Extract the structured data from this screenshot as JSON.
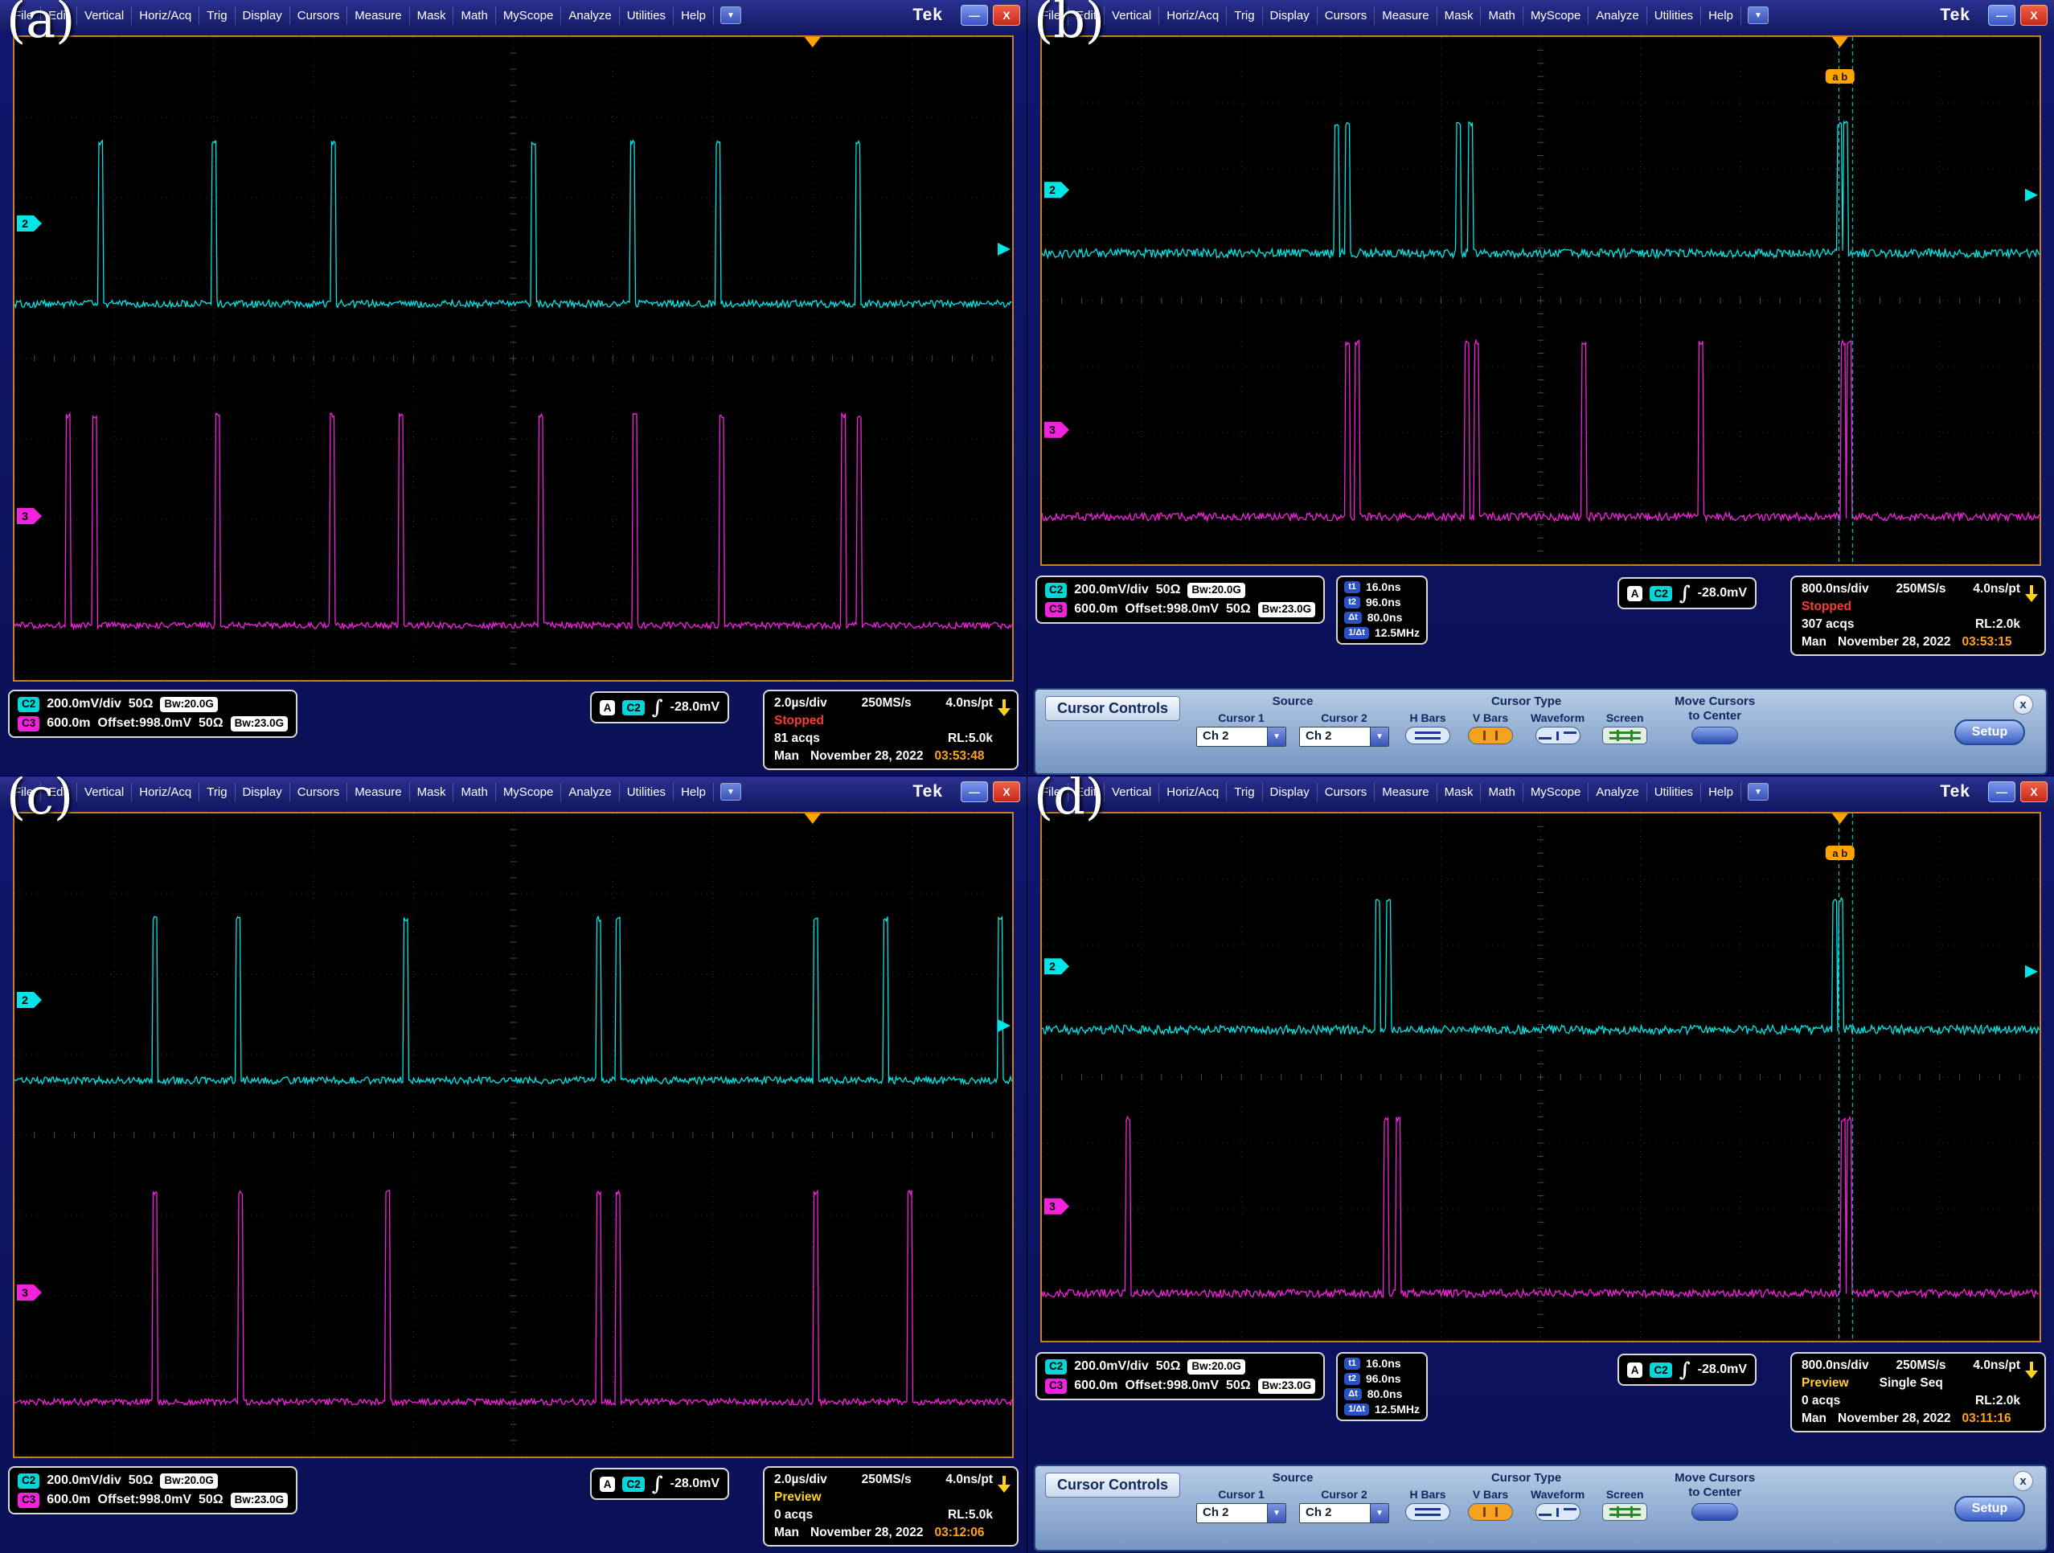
{
  "logo": "Tek",
  "icons": {
    "dropdown": "▼",
    "minimize": "—",
    "close": "X"
  },
  "menu": [
    "File",
    "Edit",
    "Vertical",
    "Horiz/Acq",
    "Trig",
    "Display",
    "Cursors",
    "Measure",
    "Mask",
    "Math",
    "MyScope",
    "Analyze",
    "Utilities",
    "Help"
  ],
  "colors": {
    "ch2": "#00e5e5",
    "ch3": "#f322dc",
    "marker_orange": "#ffa400",
    "grid": "#3a3a3a",
    "cursor": "#00e5e5"
  },
  "cursor_controls": {
    "title": "Cursor Controls",
    "source_label": "Source",
    "cursor1_label": "Cursor 1",
    "cursor2_label": "Cursor 2",
    "cursor1_value": "Ch 2",
    "cursor2_value": "Ch 2",
    "type_label": "Cursor Type",
    "type_buttons": [
      "H Bars",
      "V Bars",
      "Waveform",
      "Screen"
    ],
    "selected_type": "V Bars",
    "move_label": "Move Cursors to Center",
    "setup_label": "Setup",
    "close_label": "x"
  },
  "panels": [
    {
      "label": "(a)",
      "ch2": {
        "badge": "C2",
        "scale": "200.0mV/div",
        "impedance": "50Ω",
        "bandwidth": "Bw:20.0G"
      },
      "ch3": {
        "badge": "C3",
        "scale": "600.0m",
        "offset": "Offset:998.0mV",
        "impedance": "50Ω",
        "bandwidth": "Bw:23.0G"
      },
      "trigger": {
        "mode_badge": "A",
        "source_badge": "C2",
        "slope": "∫",
        "level": "-28.0mV"
      },
      "timebase": {
        "scale": "2.0µs/div",
        "rate": "250MS/s",
        "resolution": "4.0ns/pt"
      },
      "acq": {
        "state": "Stopped",
        "state_color": "#ff3b30",
        "extra": "",
        "count": "81 acqs",
        "record": "RL:5.0k",
        "mode": "Man",
        "date": "November 28, 2022",
        "time": "03:53:48"
      },
      "cursor_readout": null,
      "has_cursor_panel": false,
      "waveform": {
        "ch2": {
          "marker_label": "2",
          "marker_y": 0.29,
          "baseline": 0.415,
          "top": 0.16,
          "noise": 9,
          "pulses": [
            0.086,
            0.2,
            0.32,
            0.52,
            0.62,
            0.705,
            0.845
          ]
        },
        "ch3": {
          "marker_label": "3",
          "marker_y": 0.745,
          "baseline": 0.915,
          "top": 0.585,
          "noise": 8,
          "pulses": [
            0.054,
            0.08,
            0.204,
            0.319,
            0.387,
            0.528,
            0.622,
            0.709,
            0.831,
            0.847
          ]
        },
        "trigger_pos": 0.8,
        "trig_level_y": 0.33,
        "cursors": null,
        "cursor_label": null,
        "cursor_label_x": null
      }
    },
    {
      "label": "(b)",
      "ch2": {
        "badge": "C2",
        "scale": "200.0mV/div",
        "impedance": "50Ω",
        "bandwidth": "Bw:20.0G"
      },
      "ch3": {
        "badge": "C3",
        "scale": "600.0m",
        "offset": "Offset:998.0mV",
        "impedance": "50Ω",
        "bandwidth": "Bw:23.0G"
      },
      "trigger": {
        "mode_badge": "A",
        "source_badge": "C2",
        "slope": "∫",
        "level": "-28.0mV"
      },
      "timebase": {
        "scale": "800.0ns/div",
        "rate": "250MS/s",
        "resolution": "4.0ns/pt"
      },
      "acq": {
        "state": "Stopped",
        "state_color": "#ff3b30",
        "extra": "",
        "count": "307 acqs",
        "record": "RL:2.0k",
        "mode": "Man",
        "date": "November 28, 2022",
        "time": "03:53:15"
      },
      "cursor_readout": {
        "rows": [
          {
            "badge": "t1",
            "value": "16.0ns"
          },
          {
            "badge": "t2",
            "value": "96.0ns"
          },
          {
            "badge": "Δt",
            "value": "80.0ns"
          },
          {
            "badge": "1/Δt",
            "value": "12.5MHz"
          }
        ]
      },
      "has_cursor_panel": true,
      "waveform": {
        "ch2": {
          "marker_label": "2",
          "marker_y": 0.29,
          "baseline": 0.41,
          "top": 0.16,
          "noise": 11,
          "pulses": [
            0.295,
            0.307,
            0.418,
            0.43,
            0.799,
            0.805
          ]
        },
        "ch3": {
          "marker_label": "3",
          "marker_y": 0.745,
          "baseline": 0.91,
          "top": 0.575,
          "noise": 10,
          "pulses": [
            0.306,
            0.316,
            0.426,
            0.436,
            0.543,
            0.66,
            0.803,
            0.809
          ]
        },
        "trigger_pos": 0.8,
        "trig_level_y": 0.3,
        "cursors": [
          0.799,
          0.8125
        ],
        "cursor_label": "a b",
        "cursor_label_x": 0.8
      }
    },
    {
      "label": "(c)",
      "ch2": {
        "badge": "C2",
        "scale": "200.0mV/div",
        "impedance": "50Ω",
        "bandwidth": "Bw:20.0G"
      },
      "ch3": {
        "badge": "C3",
        "scale": "600.0m",
        "offset": "Offset:998.0mV",
        "impedance": "50Ω",
        "bandwidth": "Bw:23.0G"
      },
      "trigger": {
        "mode_badge": "A",
        "source_badge": "C2",
        "slope": "∫",
        "level": "-28.0mV"
      },
      "timebase": {
        "scale": "2.0µs/div",
        "rate": "250MS/s",
        "resolution": "4.0ns/pt"
      },
      "acq": {
        "state": "Preview",
        "state_color": "#ffd234",
        "extra": "",
        "count": "0 acqs",
        "record": "RL:5.0k",
        "mode": "Man",
        "date": "November 28, 2022",
        "time": "03:12:06"
      },
      "cursor_readout": null,
      "has_cursor_panel": false,
      "waveform": {
        "ch2": {
          "marker_label": "2",
          "marker_y": 0.29,
          "baseline": 0.415,
          "top": 0.16,
          "noise": 9,
          "pulses": [
            0.141,
            0.224,
            0.392,
            0.586,
            0.605,
            0.803,
            0.873,
            0.988
          ]
        },
        "ch3": {
          "marker_label": "3",
          "marker_y": 0.745,
          "baseline": 0.915,
          "top": 0.585,
          "noise": 8,
          "pulses": [
            0.141,
            0.227,
            0.374,
            0.586,
            0.605,
            0.803,
            0.897
          ]
        },
        "trigger_pos": 0.8,
        "trig_level_y": 0.33,
        "cursors": null,
        "cursor_label": null,
        "cursor_label_x": null
      }
    },
    {
      "label": "(d)",
      "ch2": {
        "badge": "C2",
        "scale": "200.0mV/div",
        "impedance": "50Ω",
        "bandwidth": "Bw:20.0G"
      },
      "ch3": {
        "badge": "C3",
        "scale": "600.0m",
        "offset": "Offset:998.0mV",
        "impedance": "50Ω",
        "bandwidth": "Bw:23.0G"
      },
      "trigger": {
        "mode_badge": "A",
        "source_badge": "C2",
        "slope": "∫",
        "level": "-28.0mV"
      },
      "timebase": {
        "scale": "800.0ns/div",
        "rate": "250MS/s",
        "resolution": "4.0ns/pt"
      },
      "acq": {
        "state": "Preview",
        "state_color": "#ffd234",
        "extra": "Single Seq",
        "count": "0 acqs",
        "record": "RL:2.0k",
        "mode": "Man",
        "date": "November 28, 2022",
        "time": "03:11:16"
      },
      "cursor_readout": {
        "rows": [
          {
            "badge": "t1",
            "value": "16.0ns"
          },
          {
            "badge": "t2",
            "value": "96.0ns"
          },
          {
            "badge": "Δt",
            "value": "80.0ns"
          },
          {
            "badge": "1/Δt",
            "value": "12.5MHz"
          }
        ]
      },
      "has_cursor_panel": true,
      "waveform": {
        "ch2": {
          "marker_label": "2",
          "marker_y": 0.29,
          "baseline": 0.41,
          "top": 0.16,
          "noise": 11,
          "pulses": [
            0.337,
            0.347,
            0.795,
            0.801
          ]
        },
        "ch3": {
          "marker_label": "3",
          "marker_y": 0.745,
          "baseline": 0.91,
          "top": 0.575,
          "noise": 10,
          "pulses": [
            0.086,
            0.345,
            0.357,
            0.803,
            0.809
          ]
        },
        "trigger_pos": 0.8,
        "trig_level_y": 0.3,
        "cursors": [
          0.799,
          0.8125
        ],
        "cursor_label": "a b",
        "cursor_label_x": 0.8
      }
    }
  ]
}
